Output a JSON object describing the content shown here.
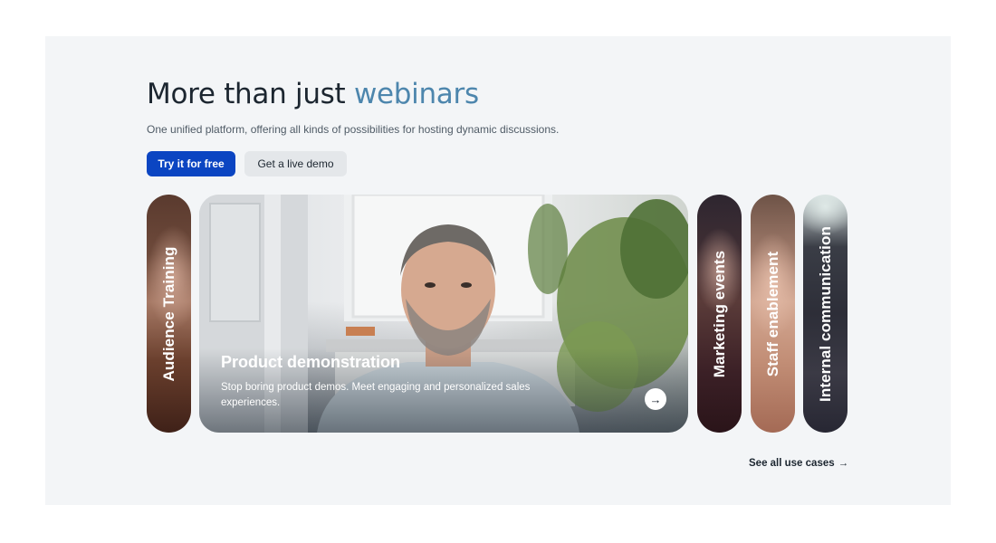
{
  "hero": {
    "title_prefix": "More than just ",
    "title_accent": "webinars",
    "subtitle": "One unified platform, offering all kinds of possibilities for hosting dynamic discussions.",
    "primary_button": "Try it for free",
    "secondary_button": "Get a live demo",
    "accent_color": "#4d86ad",
    "primary_color": "#0b45c2"
  },
  "use_cases": {
    "left_pills": [
      {
        "label": "Audience Training"
      }
    ],
    "active_card": {
      "title": "Product demonstration",
      "description": "Stop boring product demos. Meet engaging and personalized sales experiences.",
      "arrow_icon": "arrow-right-icon",
      "arrow_glyph": "→"
    },
    "right_pills": [
      {
        "label": "Marketing events"
      },
      {
        "label": "Staff enablement"
      },
      {
        "label": "Internal communication"
      }
    ],
    "see_all": "See all use cases",
    "see_all_arrow": "→"
  }
}
